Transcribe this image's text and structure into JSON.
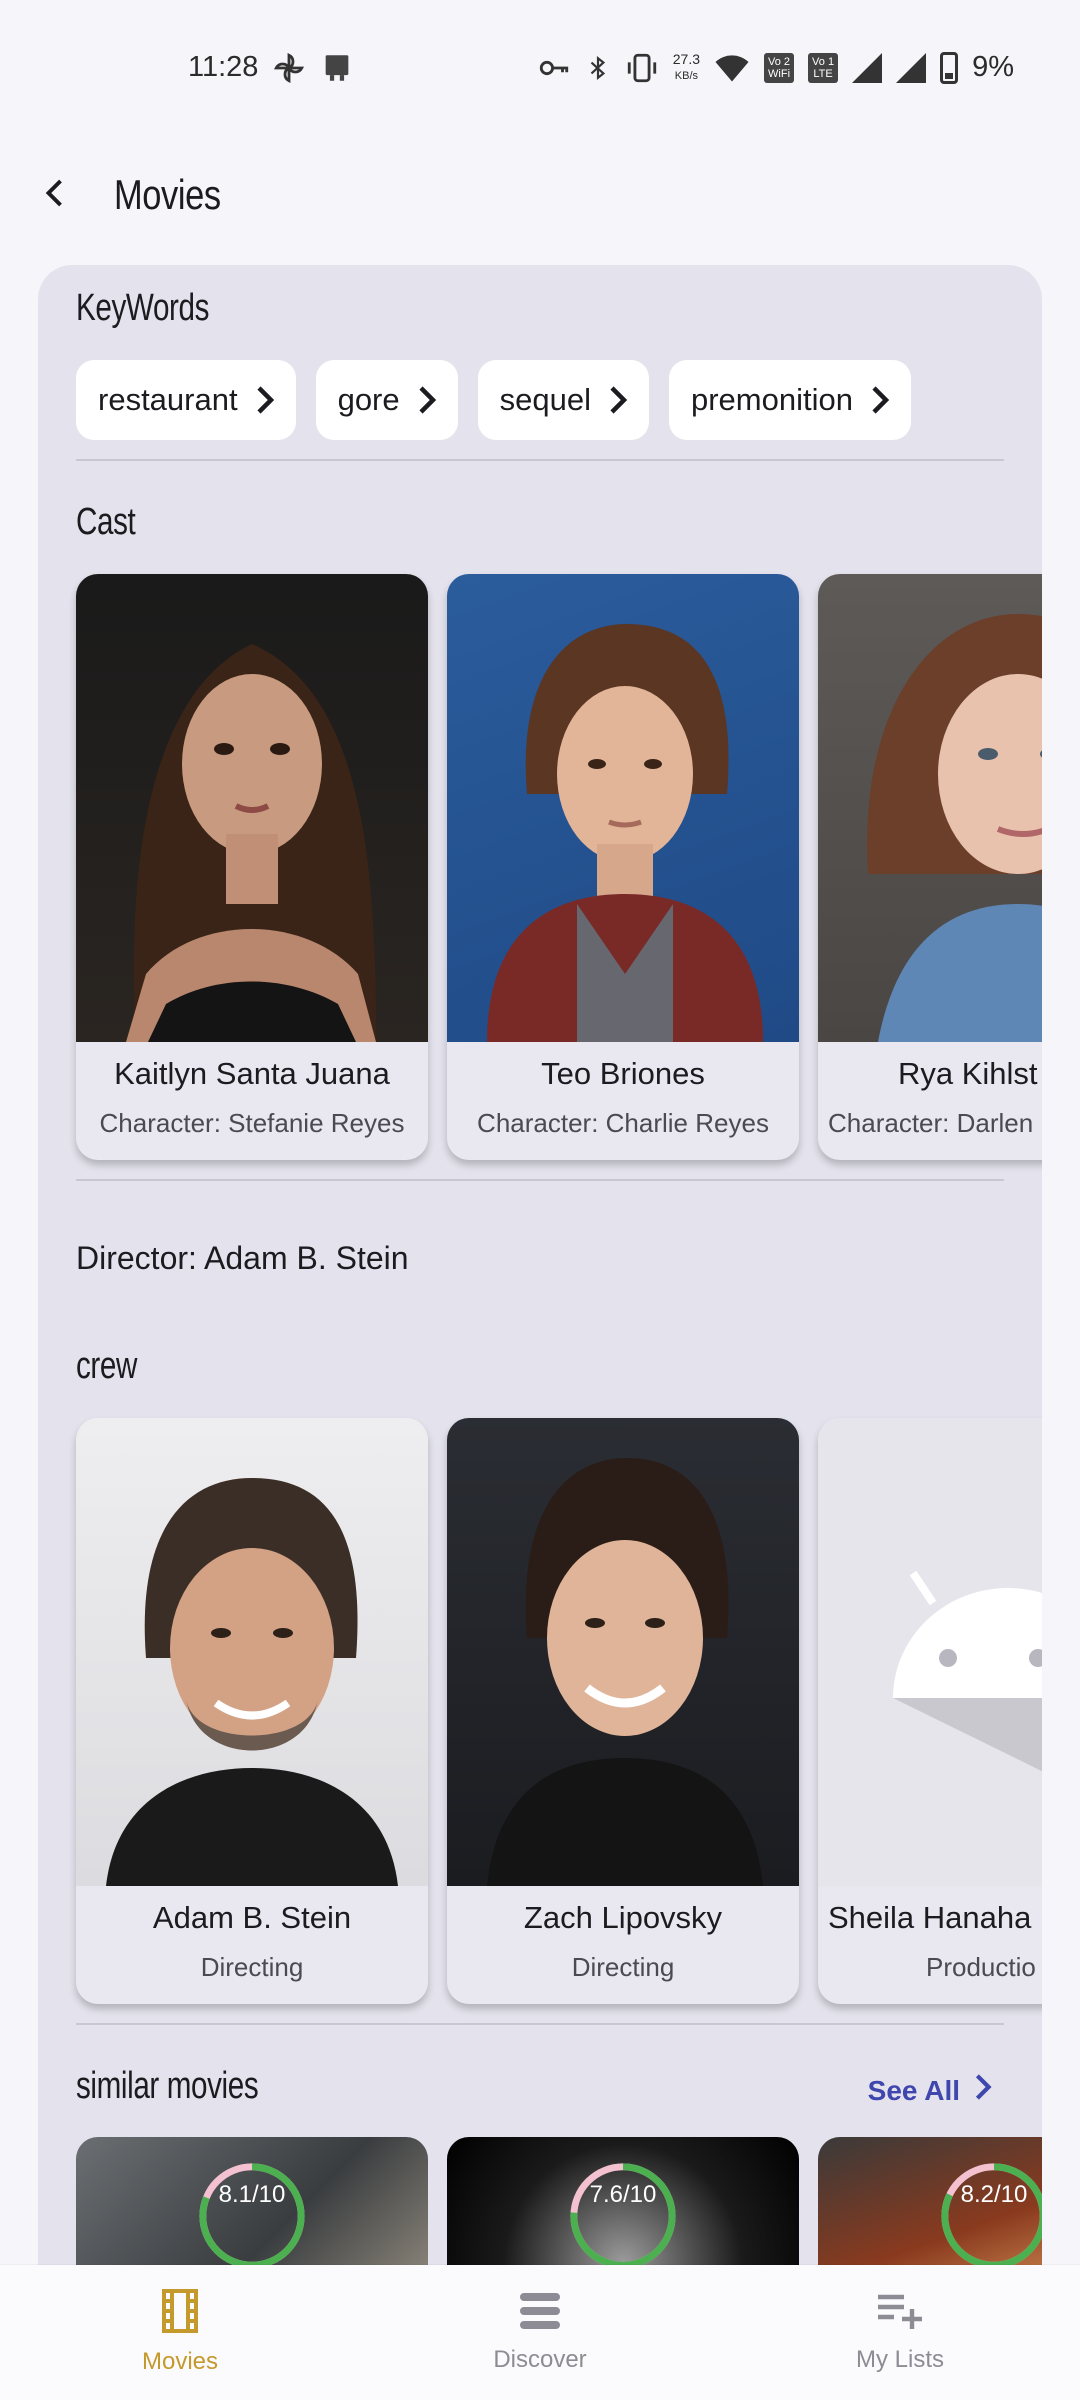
{
  "status_bar": {
    "time": "11:28",
    "network_speed": "27.3",
    "network_unit": "KB/s",
    "vowifi_badge": "Vo 2\nWiFi",
    "volte_badge": "Vo 1\nLTE",
    "battery": "9%",
    "icons": [
      "pinwheel-icon",
      "notification-icon",
      "key-icon",
      "bluetooth-icon",
      "vibrate-icon",
      "wifi-icon",
      "signal-icon",
      "battery-icon"
    ]
  },
  "app_bar": {
    "title": "Movies",
    "back_icon": "arrow-back-icon"
  },
  "keywords": {
    "title": "KeyWords",
    "items": [
      "restaurant",
      "gore",
      "sequel",
      "premonition"
    ]
  },
  "cast": {
    "title": "Cast",
    "items": [
      {
        "name": "Kaitlyn Santa Juana",
        "character": "Character: Stefanie Reyes"
      },
      {
        "name": "Teo Briones",
        "character": "Character: Charlie Reyes"
      },
      {
        "name": "Rya Kihlst",
        "character": "Character: Darlen"
      }
    ]
  },
  "director": {
    "text": "Director: Adam B. Stein"
  },
  "crew": {
    "title": "crew",
    "items": [
      {
        "name": "Adam B. Stein",
        "job": "Directing"
      },
      {
        "name": "Zach Lipovsky",
        "job": "Directing"
      },
      {
        "name": "Sheila Hanaha",
        "job": "Productio"
      }
    ]
  },
  "similar_movies": {
    "title": "similar movies",
    "see_all": "See All",
    "items": [
      {
        "rating": "8.1/10",
        "score": 0.81
      },
      {
        "rating": "7.6/10",
        "score": 0.76
      },
      {
        "rating": "8.2/10",
        "score": 0.82
      }
    ]
  },
  "bottom_nav": {
    "items": [
      {
        "label": "Movies",
        "icon": "film-icon",
        "active": true
      },
      {
        "label": "Discover",
        "icon": "stack-icon",
        "active": false
      },
      {
        "label": "My Lists",
        "icon": "playlist-add-icon",
        "active": false
      }
    ]
  },
  "colors": {
    "background": "#f6f5fa",
    "card": "#e4e3ed",
    "accent_active": "#c49a2c",
    "see_all": "#3f46ad",
    "rating_ring": "#4caf50"
  }
}
